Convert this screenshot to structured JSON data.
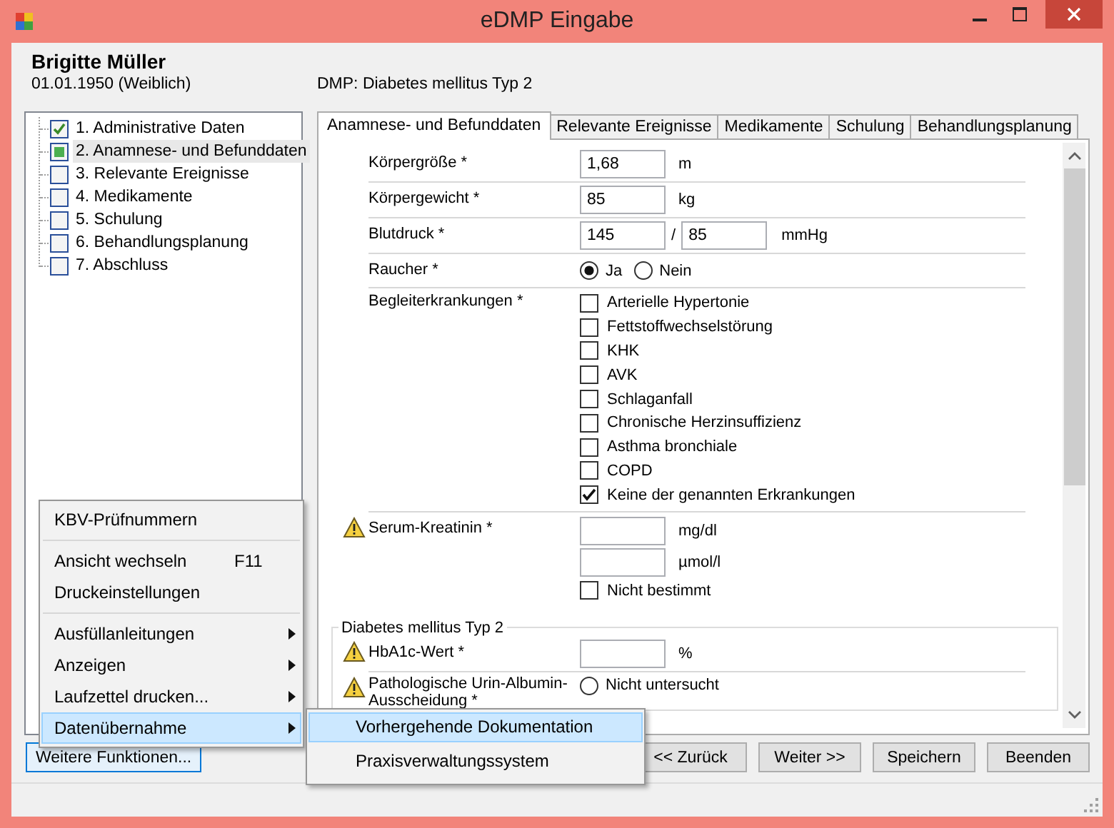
{
  "window": {
    "title": "eDMP Eingabe"
  },
  "patient": {
    "name": "Brigitte Müller",
    "birth": "01.01.1950 (Weiblich)",
    "program": "DMP: Diabetes mellitus Typ 2"
  },
  "nav": [
    {
      "label": "1. Administrative Daten",
      "checked": true,
      "in_progress": false,
      "selected": false
    },
    {
      "label": "2. Anamnese- und Befunddaten",
      "checked": false,
      "in_progress": true,
      "selected": true
    },
    {
      "label": "3. Relevante Ereignisse",
      "checked": false,
      "in_progress": false,
      "selected": false
    },
    {
      "label": "4. Medikamente",
      "checked": false,
      "in_progress": false,
      "selected": false
    },
    {
      "label": "5. Schulung",
      "checked": false,
      "in_progress": false,
      "selected": false
    },
    {
      "label": "6. Behandlungsplanung",
      "checked": false,
      "in_progress": false,
      "selected": false
    },
    {
      "label": "7. Abschluss",
      "checked": false,
      "in_progress": false,
      "selected": false
    }
  ],
  "tabs": [
    {
      "label": "Anamnese- und Befunddaten",
      "selected": true
    },
    {
      "label": "Relevante Ereignisse",
      "selected": false
    },
    {
      "label": "Medikamente",
      "selected": false
    },
    {
      "label": "Schulung",
      "selected": false
    },
    {
      "label": "Behandlungsplanung",
      "selected": false
    }
  ],
  "form": {
    "rows": [
      {
        "kind": "input",
        "label": "Körpergröße *",
        "warning": false,
        "value": "1,68",
        "unit": "m"
      },
      {
        "kind": "input",
        "label": "Körpergewicht *",
        "warning": false,
        "value": "85",
        "unit": "kg"
      },
      {
        "kind": "pair",
        "label": "Blutdruck *",
        "warning": false,
        "values": [
          "145",
          "85"
        ],
        "separator": "/",
        "unit": "mmHg"
      },
      {
        "kind": "radio",
        "label": "Raucher *",
        "warning": false,
        "options": [
          {
            "label": "Ja",
            "selected": true
          },
          {
            "label": "Nein",
            "selected": false
          }
        ]
      },
      {
        "kind": "checklist",
        "label": "Begleiterkrankungen *",
        "warning": false,
        "options": [
          {
            "label": "Arterielle Hypertonie",
            "checked": false
          },
          {
            "label": "Fettstoffwechselstörung",
            "checked": false
          },
          {
            "label": "KHK",
            "checked": false
          },
          {
            "label": "AVK",
            "checked": false
          },
          {
            "label": "Schlaganfall",
            "checked": false
          },
          {
            "label": "Chronische Herzinsuffizienz",
            "checked": false
          },
          {
            "label": "Asthma bronchiale",
            "checked": false
          },
          {
            "label": "COPD",
            "checked": false
          },
          {
            "label": "Keine der genannten Erkrankungen",
            "checked": true
          }
        ]
      },
      {
        "kind": "multi",
        "label": "Serum-Kreatinin *",
        "warning": true,
        "inputs": [
          {
            "unit": "mg/dl"
          },
          {
            "unit": "µmol/l"
          }
        ],
        "option": {
          "label": "Nicht bestimmt",
          "checked": false
        }
      }
    ],
    "group": {
      "title": "Diabetes mellitus Typ 2",
      "rows": [
        {
          "kind": "input",
          "label": "HbA1c-Wert *",
          "warning": true,
          "unit": "%"
        },
        {
          "kind": "radio",
          "label": "Pathologische Urin-Albumin-Ausscheidung *",
          "warning": true,
          "options": [
            {
              "label": "Nicht untersucht",
              "selected": false
            }
          ]
        }
      ]
    }
  },
  "more_button": {
    "label": "Weitere Funktionen...",
    "active": true
  },
  "buttons": [
    "<<  Zurück",
    "Weiter  >>",
    "Speichern",
    "Beenden"
  ],
  "menu": {
    "items": [
      {
        "kind": "item",
        "label": "KBV-Prüfnummern",
        "submenu": false,
        "selected": false
      },
      {
        "kind": "separator"
      },
      {
        "kind": "item",
        "label": "Ansicht wechseln",
        "shortcut": "F11",
        "submenu": false,
        "selected": false
      },
      {
        "kind": "item",
        "label": "Druckeinstellungen",
        "submenu": false,
        "selected": false
      },
      {
        "kind": "separator"
      },
      {
        "kind": "item",
        "label": "Ausfüllanleitungen",
        "submenu": true,
        "selected": false
      },
      {
        "kind": "item",
        "label": "Anzeigen",
        "submenu": true,
        "selected": false
      },
      {
        "kind": "item",
        "label": "Laufzettel drucken...",
        "submenu": true,
        "selected": false
      },
      {
        "kind": "item",
        "label": "Datenübernahme",
        "submenu": true,
        "selected": true
      }
    ]
  },
  "submenu": {
    "items": [
      {
        "label": "Vorhergehende Dokumentation",
        "selected": true
      },
      {
        "label": "Praxisverwaltungssystem",
        "selected": false
      }
    ]
  }
}
